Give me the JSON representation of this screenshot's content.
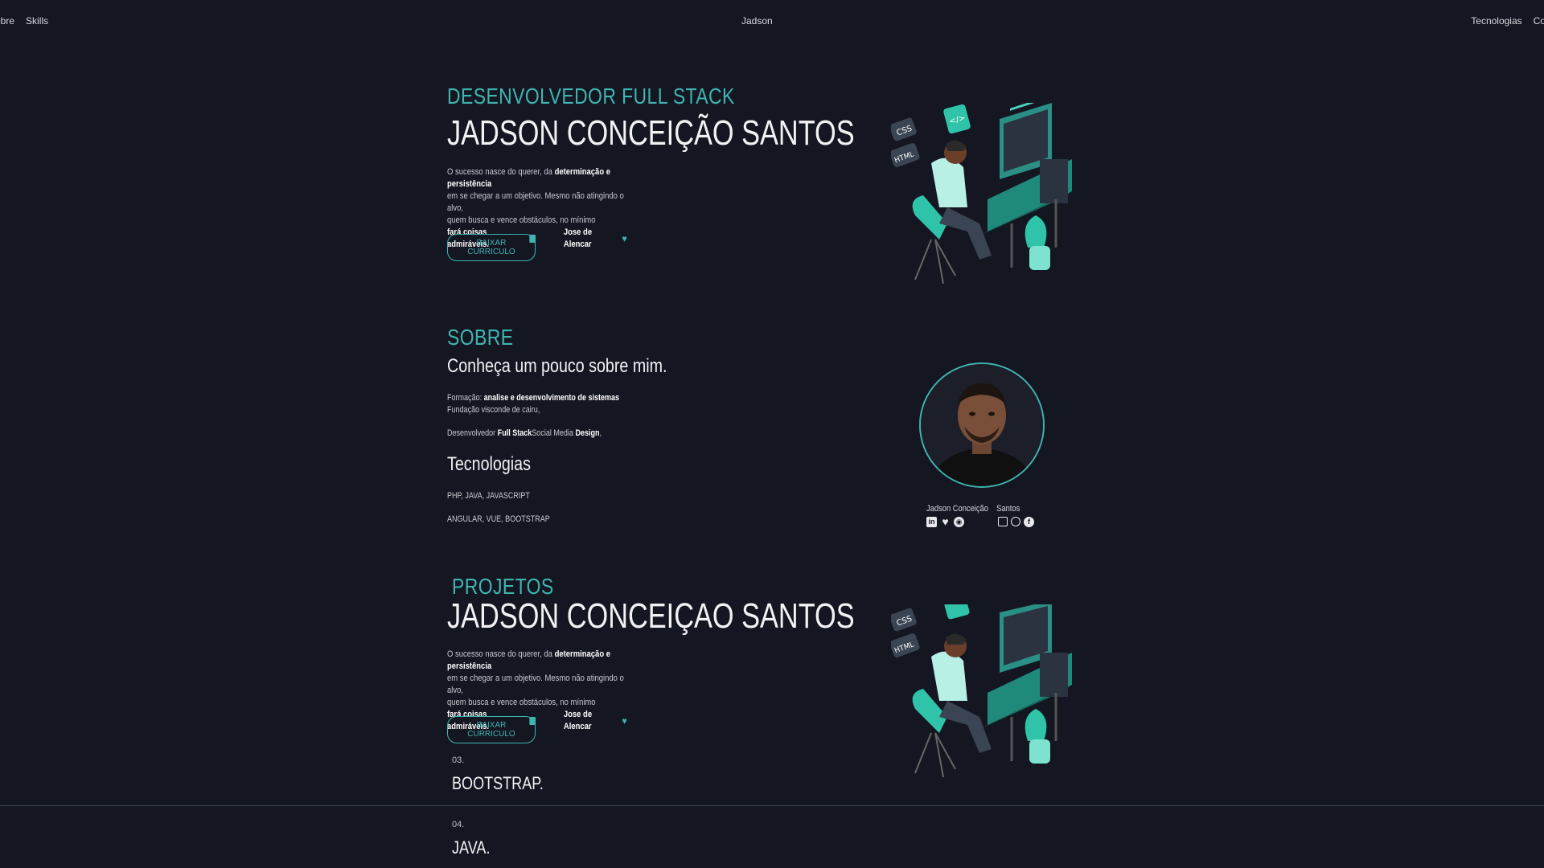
{
  "nav": {
    "left": [
      "obre",
      "Skills"
    ],
    "center": "Jadson",
    "right": [
      "Tecnologias",
      "Contat"
    ]
  },
  "hero": {
    "kicker": "DESENVOLVEDOR FULL STACK",
    "name": "JADSON CONCEIÇÃO SANTOS",
    "quote_1a": "O sucesso nasce do querer, da ",
    "quote_1b": "determinação e persistência",
    "quote_2": "em se chegar a um objetivo. Mesmo não atingindo o alvo,",
    "quote_3": "quem busca e vence obstáculos, no mínimo",
    "quote_4": "fará coisas admiráveis.",
    "author": "Jose de Alencar",
    "button": "BAIXAR CURRICULO"
  },
  "about": {
    "kicker": "SOBRE",
    "title": "Conheça um pouco sobre mim.",
    "formacao_label": "Formação: ",
    "formacao_value": "analise e desenvolvimento de sistemas",
    "instituicao": "Fundação visconde de cairu,",
    "dev_a": "Desenvolvedor ",
    "dev_b": "Full Stack",
    "dev_c": "Social Media ",
    "dev_d": "Design",
    "dev_e": ",",
    "tech_title": "Tecnologias",
    "tech_line_1": "PHP, JAVA, JAVASCRIPT",
    "tech_line_2": "ANGULAR, VUE, BOOTSTRAP",
    "social_name_1": "Jadson Conceição",
    "social_name_2": "Santos"
  },
  "projects": {
    "kicker": "PROJETOS",
    "name": "JADSON CONCEIÇAO SANTOS",
    "quote_1a": "O sucesso nasce do querer, da ",
    "quote_1b": "determinação e persistência",
    "quote_2": "em se chegar a um objetivo. Mesmo não atingindo o alvo,",
    "quote_3": "quem busca e vence obstáculos, no mínimo",
    "quote_4": "fará coisas admiráveis.",
    "author": "Jose de Alencar",
    "button": "BAIXAR CURRICULO"
  },
  "skills": [
    {
      "num": "03.",
      "name": "BOOTSTRAP."
    },
    {
      "num": "04.",
      "name": "JAVA."
    }
  ],
  "icons": {
    "quote_mark": "edit-icon",
    "heart": "heart-icon",
    "social_left": [
      "linkedin-icon",
      "heart-icon",
      "github-icon"
    ],
    "social_right": [
      "instagram-icon",
      "whatsapp-icon",
      "facebook-icon"
    ]
  },
  "colors": {
    "background": "#141621",
    "accent": "#3fb5b0",
    "text": "#f2f2f4"
  }
}
